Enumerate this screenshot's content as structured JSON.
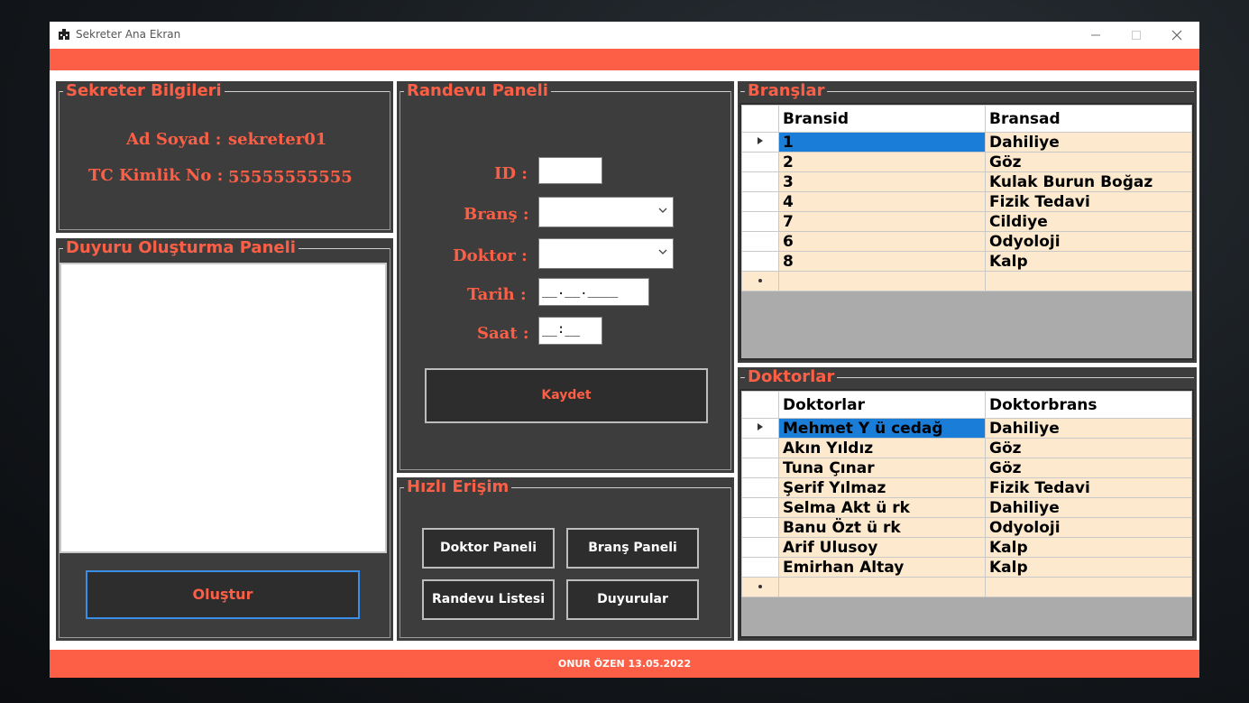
{
  "window": {
    "title": "Sekreter Ana Ekran",
    "footer_text": "ONUR ÖZEN 13.05.2022"
  },
  "colors": {
    "accent": "#fc5f45",
    "panel": "#3d3d3d",
    "grid_row": "#fde9cd",
    "selection": "#1a7ed8"
  },
  "sekreter": {
    "group_title": "Sekreter Bilgileri",
    "name_label": "Ad Soyad :",
    "name_value": "sekreter01",
    "tc_label": "TC Kimlik No :",
    "tc_value": "55555555555"
  },
  "duyuru": {
    "group_title": "Duyuru Oluşturma Paneli",
    "text_value": "",
    "create_button": "Oluştur"
  },
  "randevu": {
    "group_title": "Randevu Paneli",
    "id_label": "ID :",
    "id_value": "",
    "brans_label": "Branş :",
    "brans_value": "",
    "doktor_label": "Doktor :",
    "doktor_value": "",
    "tarih_label": "Tarih :",
    "tarih_value": "__.__.____",
    "saat_label": "Saat :",
    "saat_value": "__:__",
    "save_button": "Kaydet"
  },
  "hizli": {
    "group_title": "Hızlı Erişim",
    "doktor_panel_button": "Doktor Paneli",
    "brans_panel_button": "Branş Paneli",
    "randevu_list_button": "Randevu Listesi",
    "duyurular_button": "Duyurular"
  },
  "branslar": {
    "group_title": "Branşlar",
    "columns": [
      "Bransid",
      "Bransad"
    ],
    "rows": [
      [
        "1",
        "Dahiliye"
      ],
      [
        "2",
        "Göz"
      ],
      [
        "3",
        "Kulak Burun Boğaz"
      ],
      [
        "4",
        "Fizik Tedavi"
      ],
      [
        "7",
        "Cildiye"
      ],
      [
        "6",
        "Odyoloji"
      ],
      [
        "8",
        "Kalp"
      ]
    ],
    "selected_row": 0
  },
  "doktorlar": {
    "group_title": "Doktorlar",
    "columns": [
      "Doktorlar",
      "Doktorbrans"
    ],
    "rows": [
      [
        "Mehmet Y ü cedağ",
        "Dahiliye"
      ],
      [
        "Akın  Yıldız",
        "Göz"
      ],
      [
        "Tuna Çınar",
        "Göz"
      ],
      [
        "Şerif Yılmaz",
        "Fizik Tedavi"
      ],
      [
        "Selma  Akt ü rk",
        "Dahiliye"
      ],
      [
        "Banu Özt ü rk",
        "Odyoloji"
      ],
      [
        "Arif Ulusoy",
        "Kalp"
      ],
      [
        "Emirhan Altay",
        "Kalp"
      ]
    ],
    "selected_row": 0
  },
  "icons": {
    "row_current": "triangle-right-icon",
    "row_new": "asterisk-icon",
    "combo": "chevron-down-icon"
  }
}
